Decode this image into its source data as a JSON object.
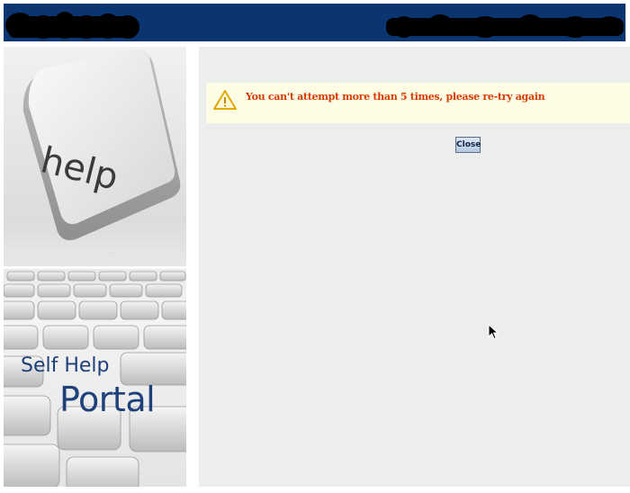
{
  "header": {
    "background_color": "#0b3570",
    "brand_logo_icon": "company-wordmark-logo",
    "tagline_icon": "company-tagline-logo"
  },
  "sidebar": {
    "image_icon": "help-key-keyboard-image",
    "key_label": "help",
    "portal_title_line1": "Self Help",
    "portal_title_line2": "Portal"
  },
  "alert": {
    "icon": "warning-icon",
    "message": "You can't attempt more than 5 times, please re-try again",
    "text_color": "#d63c00",
    "background_color": "#fdfde6"
  },
  "actions": {
    "close_label": "Close"
  },
  "colors": {
    "main_background": "#eceeee",
    "brand_text": "#1d3f7a"
  }
}
